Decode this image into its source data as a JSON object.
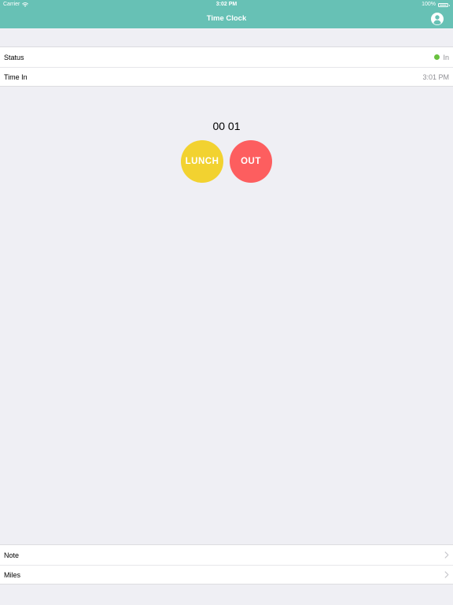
{
  "status_bar": {
    "carrier": "Carrier",
    "time": "3:02 PM",
    "battery": "100%",
    "icons": [
      "wifi-icon",
      "battery-icon"
    ]
  },
  "nav": {
    "title": "Time Clock",
    "profile_icon": "user-circle-icon"
  },
  "info": {
    "status_label": "Status",
    "status_value": "In",
    "status_color": "#69c13f",
    "time_in_label": "Time In",
    "time_in_value": "3:01 PM"
  },
  "timer": {
    "display": "00 01"
  },
  "actions": {
    "lunch_label": "LUNCH",
    "lunch_color": "#f2d230",
    "out_label": "OUT",
    "out_color": "#fd5e5f"
  },
  "details": {
    "note_label": "Note",
    "miles_label": "Miles",
    "chevron_icon": "chevron-right-icon"
  },
  "colors": {
    "header": "#67c1b5",
    "background": "#efeff4"
  }
}
